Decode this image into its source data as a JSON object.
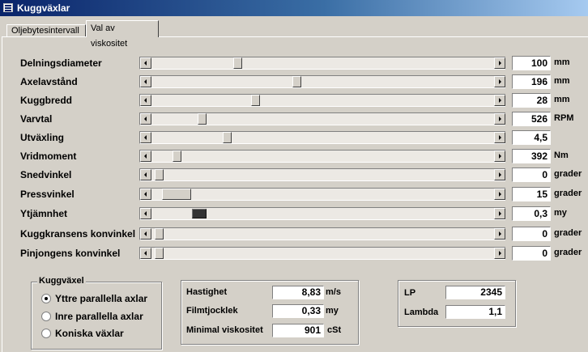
{
  "window": {
    "title": "Kuggväxlar",
    "icon": "form-icon"
  },
  "tabs": [
    {
      "label": "Oljebytesintervall",
      "active": false
    },
    {
      "label": "Val av viskositet",
      "active": true
    }
  ],
  "sliders": [
    {
      "label": "Delningsdiameter",
      "value": "100",
      "unit": "mm",
      "level": 0.23
    },
    {
      "label": "Axelavstånd",
      "value": "196",
      "unit": "mm",
      "level": 0.41
    },
    {
      "label": "Kuggbredd",
      "value": "28",
      "unit": "mm",
      "level": 0.29
    },
    {
      "label": "Varvtal",
      "value": "526",
      "unit": "RPM",
      "level": 0.13
    },
    {
      "label": "Utväxling",
      "value": "4,5",
      "unit": "",
      "level": 0.2
    },
    {
      "label": "Vridmoment",
      "value": "392",
      "unit": "Nm",
      "level": 0.06
    },
    {
      "label": "Snedvinkel",
      "value": "0",
      "unit": "grader",
      "level": 0.01
    },
    {
      "label": "Pressvinkel",
      "value": "15",
      "unit": "grader",
      "level": 0.03
    },
    {
      "label": "Ytjämnhet",
      "value": "0,3",
      "unit": "my",
      "level": 0.14
    },
    {
      "label": "Kuggkransens konvinkel",
      "value": "0",
      "unit": "grader",
      "level": 0.01
    },
    {
      "label": "Pinjongens konvinkel",
      "value": "0",
      "unit": "grader",
      "level": 0.01
    }
  ],
  "gear_group": {
    "title": "Kuggväxel",
    "options": [
      {
        "label": "Yttre parallella axlar",
        "checked": true
      },
      {
        "label": "Inre parallella axlar",
        "checked": false
      },
      {
        "label": "Koniska växlar",
        "checked": false
      }
    ]
  },
  "results": {
    "hastighet": {
      "label": "Hastighet",
      "value": "8,83",
      "unit": "m/s"
    },
    "filmtjocklek": {
      "label": "Filmtjocklek",
      "value": "0,33",
      "unit": "my"
    },
    "viskositet": {
      "label": "Minimal viskositet",
      "value": "901",
      "unit": "cSt"
    }
  },
  "lp": {
    "label": "LP",
    "value": "2345"
  },
  "lambda": {
    "label": "Lambda",
    "value": "1,1"
  },
  "colors": {
    "titlebar_start": "#0a246a",
    "titlebar_end": "#a6caf0",
    "face": "#d4d0c8"
  }
}
